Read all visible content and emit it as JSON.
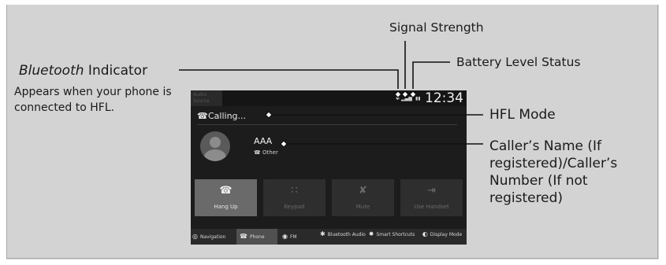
{
  "annotations": {
    "signal_strength": "Signal Strength",
    "battery_level": "Battery Level Status",
    "bluetooth_indicator_italic": "Bluetooth",
    "bluetooth_indicator_rest": " Indicator",
    "bluetooth_description": "Appears when your phone is connected to HFL.",
    "hfl_mode": "HFL Mode",
    "caller_name_line1": "Caller’s Name (If",
    "caller_name_line2": "registered)/Caller’s",
    "caller_name_line3": "Number (If not",
    "caller_name_line4": "registered)"
  },
  "screen": {
    "top_left_tab": "Audio\nSource",
    "clock": "12:34",
    "status_icons": [
      "bluetooth-icon",
      "signal-icon",
      "battery-icon"
    ],
    "calling_label": "Calling...",
    "caller_name": "AAA",
    "caller_type": "Other",
    "buttons": [
      {
        "label": "Hang Up",
        "icon": "hang-up-icon",
        "active": true
      },
      {
        "label": "Keypad",
        "icon": "keypad-icon",
        "active": false
      },
      {
        "label": "Mute",
        "icon": "mute-icon",
        "active": false
      },
      {
        "label": "Use Handset",
        "icon": "handset-icon",
        "active": false
      }
    ],
    "bottom_nav": [
      {
        "label": "Navigation",
        "icon": "navigation-icon"
      },
      {
        "label": "Phone",
        "icon": "phone-icon",
        "active": true
      },
      {
        "label": "FM",
        "icon": "fm-icon"
      },
      {
        "label": "Bluetooth Audio",
        "icon": "bluetooth-icon"
      },
      {
        "label": "Smart Shortcuts",
        "icon": "smart-shortcuts-icon"
      },
      {
        "label": "Display Mode",
        "icon": "display-mode-icon"
      }
    ]
  },
  "colors": {
    "panel": "#d3d3d3",
    "screen": "#1c1c1c",
    "active_button": "#6a6a6a"
  }
}
